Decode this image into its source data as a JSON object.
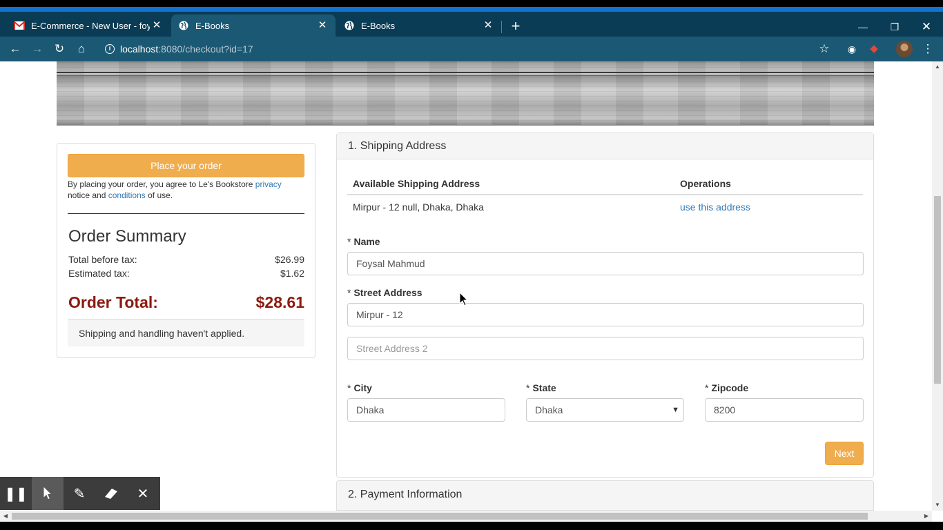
{
  "browser": {
    "tabs": [
      {
        "title": "E-Commerce - New User - foysal",
        "favicon": "gmail-icon"
      },
      {
        "title": "E-Books",
        "favicon": "globe-icon"
      },
      {
        "title": "E-Books",
        "favicon": "globe-icon"
      }
    ],
    "active_tab": 1,
    "url_host": "localhost",
    "url_rest": ":8080/checkout?id=17",
    "accent_color": "#1273d4",
    "chrome_color": "#1b5873"
  },
  "summary": {
    "place_order_label": "Place your order",
    "agree_prefix": "By placing your order, you agree to Le's Bookstore ",
    "privacy_link": "privacy",
    "agree_middle": " notice and ",
    "conditions_link": "conditions",
    "agree_suffix": " of use.",
    "title": "Order Summary",
    "rows": [
      {
        "label": "Total before tax:",
        "value": "$26.99"
      },
      {
        "label": "Estimated tax:",
        "value": "$1.62"
      }
    ],
    "total_label": "Order Total:",
    "total_value": "$28.61",
    "shipping_note": "Shipping and handling haven't applied."
  },
  "shipping": {
    "heading": "1. Shipping Address",
    "table": {
      "headers": [
        "Available Shipping Address",
        "Operations"
      ],
      "rows": [
        {
          "address": "Mirpur - 12 null, Dhaka, Dhaka",
          "action": "use this address"
        }
      ]
    },
    "required_mark": "*",
    "name_label": "Name",
    "name_value": "Foysal Mahmud",
    "street_label": "Street Address",
    "street_value": "Mirpur - 12",
    "street2_placeholder": "Street Address 2",
    "city_label": "City",
    "city_value": "Dhaka",
    "state_label": "State",
    "state_value": "Dhaka",
    "zip_label": "Zipcode",
    "zip_value": "8200",
    "next_label": "Next"
  },
  "payment": {
    "heading": "2. Payment Information"
  },
  "colors": {
    "warning_button": "#f0ad4e",
    "order_total": "#8b1a10",
    "link": "#337ab7"
  }
}
